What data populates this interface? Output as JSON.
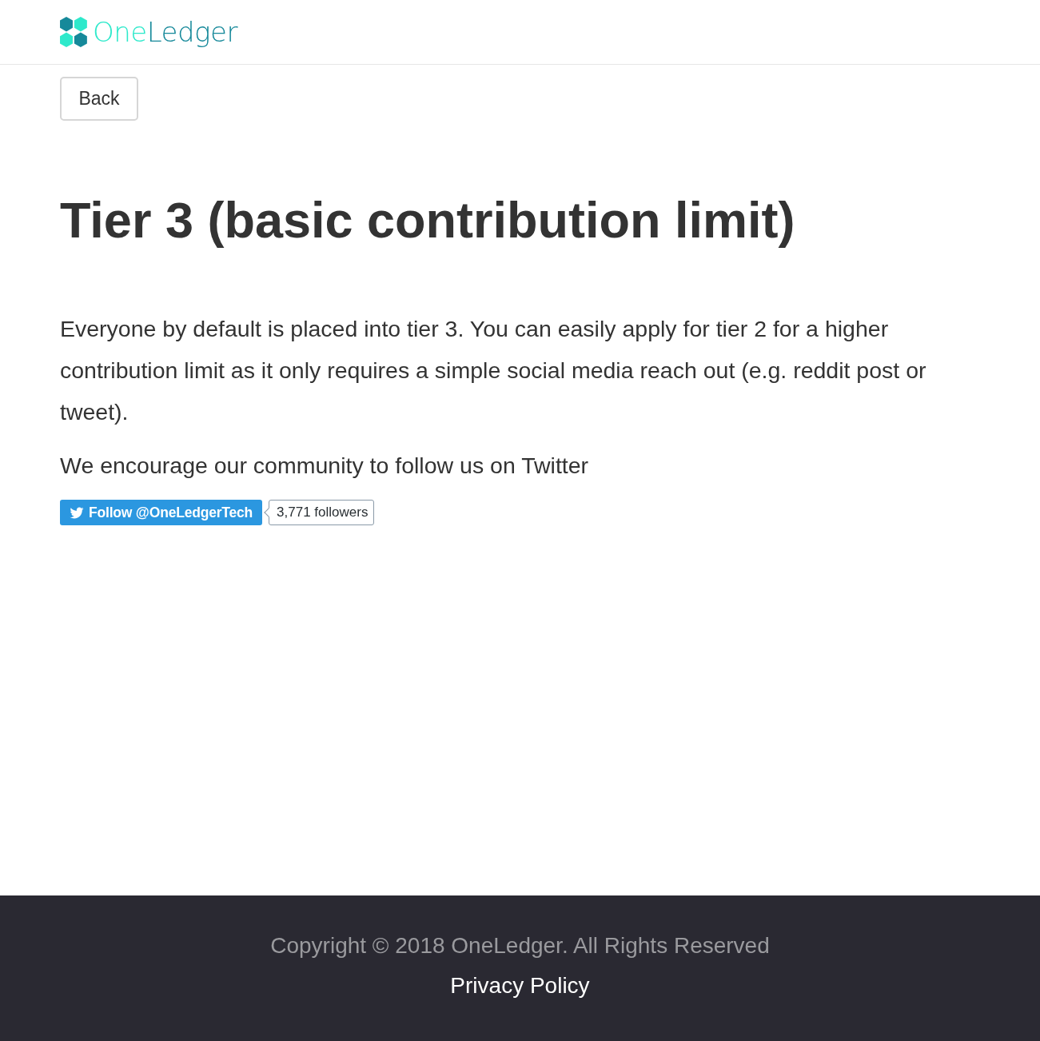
{
  "header": {
    "logo": {
      "parts": [
        "One",
        "Ledger"
      ]
    }
  },
  "back_button": {
    "label": "Back"
  },
  "heading": "Tier 3 (basic contribution limit)",
  "paragraphs": [
    "Everyone by default is placed into tier 3. You can easily apply for tier 2 for a higher contribution limit as it only requires a simple social media reach out (e.g. reddit post or tweet).",
    "We encourage our community to follow us on Twitter"
  ],
  "twitter_follow": {
    "label": "Follow @OneLedgerTech",
    "followers": "3,771 followers"
  },
  "footer": {
    "copyright": "Copyright © 2018 OneLedger. All Rights Reserved",
    "links": [
      "Privacy Policy"
    ]
  }
}
